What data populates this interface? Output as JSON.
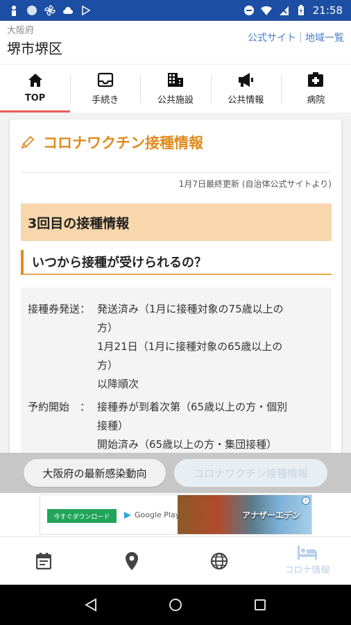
{
  "status_bar": {
    "time": "21:58"
  },
  "header": {
    "prefecture": "大阪府",
    "city": "堺市堺区",
    "links": [
      "公式サイト",
      "地域一覧"
    ]
  },
  "tabs": [
    {
      "label": "TOP",
      "icon": "home-icon",
      "active": true
    },
    {
      "label": "手続き",
      "icon": "inbox-icon",
      "active": false
    },
    {
      "label": "公共施設",
      "icon": "building-icon",
      "active": false
    },
    {
      "label": "公共情報",
      "icon": "megaphone-icon",
      "active": false
    },
    {
      "label": "病院",
      "icon": "hospital-icon",
      "active": false
    }
  ],
  "card": {
    "title": "コロナワクチン接種情報",
    "updated": "1月7日最終更新 (自治体公式サイトより)",
    "section_title": "3回目の接種情報",
    "question": "いつから接種が受けられるの？",
    "rows": [
      {
        "key": "接種券発送：",
        "lines": [
          "発送済み（1月に接種対象の75歳以上の",
          "方）",
          "1月21日（1月に接種対象の65歳以上の",
          "方）",
          "以降順次"
        ]
      },
      {
        "key": "予約開始　：",
        "lines": [
          "接種券が到着次第（65歳以上の方・個別",
          "接種）",
          "開始済み（65歳以上の方・集団接種）"
        ]
      }
    ]
  },
  "pills": {
    "left": "大阪府の最新感染動向",
    "right": "コロナワクチン接種情報"
  },
  "ad": {
    "download": "今すぐダウンロード",
    "store": "Google Play",
    "game_logo": "アナザーエデン"
  },
  "bottom_nav": [
    {
      "icon": "calendar-icon",
      "label": ""
    },
    {
      "icon": "location-pin-icon",
      "label": ""
    },
    {
      "icon": "globe-icon",
      "label": ""
    },
    {
      "icon": "bed-icon",
      "label": "コロナ情報"
    }
  ],
  "colors": {
    "status_bar": "#1c4fa3",
    "accent_orange": "#e08a1e",
    "band": "#f7d7ab",
    "active_tab": "#e55a5a",
    "link_blue": "#4a7ec8"
  }
}
